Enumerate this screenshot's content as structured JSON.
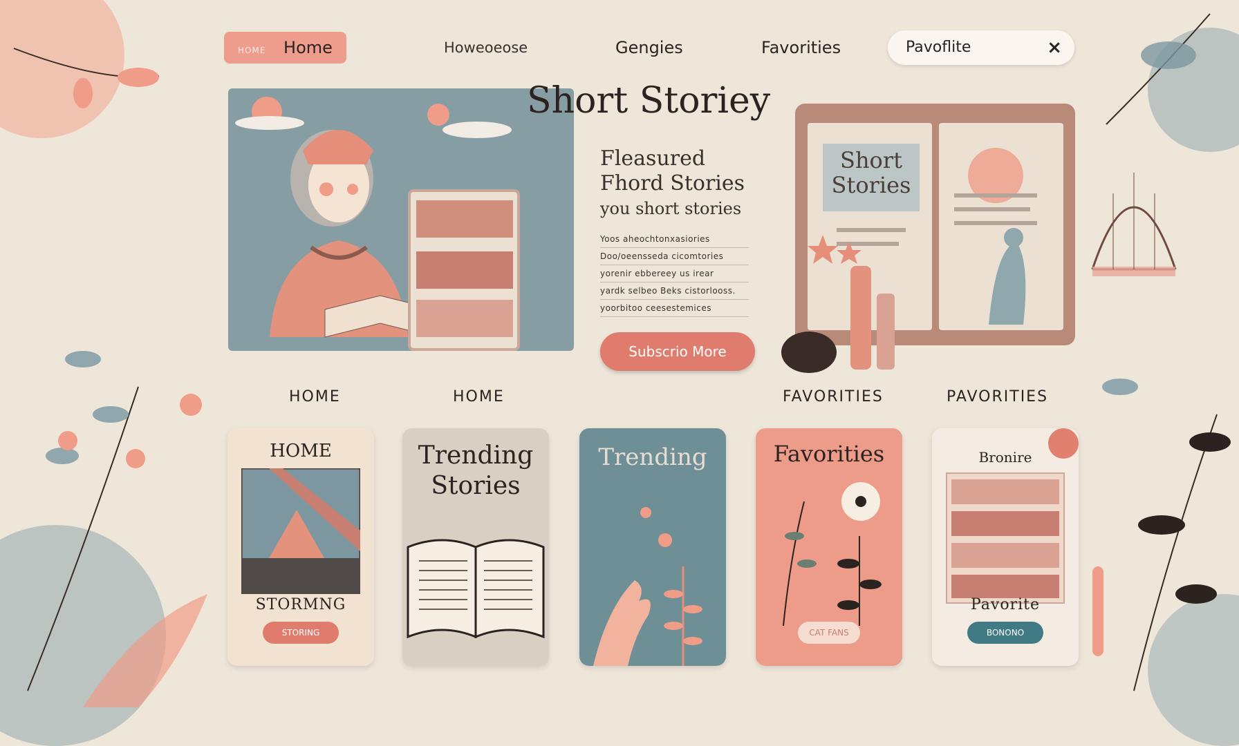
{
  "nav": {
    "home_prefix": "HOME",
    "home": "Home",
    "item2": "Howeoeose",
    "genres": "Gengies",
    "favorites": "Favorities",
    "search_value": "Pavoflite",
    "close_glyph": "×"
  },
  "hero": {
    "title": "Short Storiey",
    "featured": [
      "Fleasured",
      "Fhord Stories",
      "you short stories"
    ],
    "description": [
      "Yoos aheochtonxasiories",
      "Doo/oeensseda cicomtories",
      "yorenir ebbereey us irear",
      "yardk selbeo Beks cistorlooss.",
      "yoorbitoo ceesestemices"
    ],
    "cta": "Subscrio More",
    "book_text": [
      "Short",
      "Stories"
    ]
  },
  "sublabels": [
    "HOME",
    "HOME",
    "FAVORITIES",
    "PAVORITIES"
  ],
  "cards": [
    {
      "title": "HOME",
      "footer": "STORMNG",
      "button": "STORING",
      "bg": "#f2e2d2"
    },
    {
      "title_lines": [
        "Trending",
        "Stories"
      ],
      "bg": "#d9cfc3"
    },
    {
      "title": "Trending",
      "bg": "#6f8f97"
    },
    {
      "title": "Favorities",
      "button": "CAT FANS",
      "bg": "#ec9c88"
    },
    {
      "title": "Bronire",
      "footer": "Pavorite",
      "button": "BONONO",
      "bg": "#f4ece2"
    }
  ],
  "colors": {
    "coral": "#df7c6d",
    "slate": "#6f8f97",
    "cream": "#efe6da",
    "peach": "#ee9d8c"
  }
}
